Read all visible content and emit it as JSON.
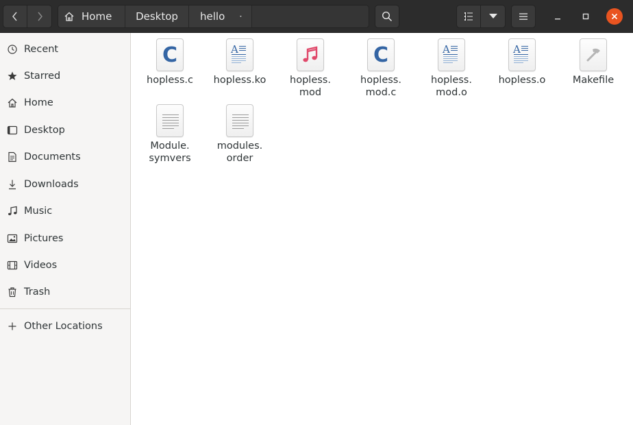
{
  "window": {
    "nav_back_icon": "chevron-left-icon",
    "nav_forward_icon": "chevron-right-icon"
  },
  "breadcrumb": {
    "items": [
      "Home",
      "Desktop",
      "hello"
    ]
  },
  "sidebar": {
    "items": [
      {
        "label": "Recent",
        "icon": "recent-icon"
      },
      {
        "label": "Starred",
        "icon": "star-icon"
      },
      {
        "label": "Home",
        "icon": "home-icon"
      },
      {
        "label": "Desktop",
        "icon": "desktop-icon"
      },
      {
        "label": "Documents",
        "icon": "documents-icon"
      },
      {
        "label": "Downloads",
        "icon": "downloads-icon"
      },
      {
        "label": "Music",
        "icon": "music-icon"
      },
      {
        "label": "Pictures",
        "icon": "pictures-icon"
      },
      {
        "label": "Videos",
        "icon": "videos-icon"
      },
      {
        "label": "Trash",
        "icon": "trash-icon"
      }
    ],
    "other_locations": "Other Locations"
  },
  "files": [
    {
      "line1": "hopless.c",
      "line2": "",
      "type": "c-source"
    },
    {
      "line1": "hopless.ko",
      "line2": "",
      "type": "text-doc"
    },
    {
      "line1": "hopless.",
      "line2": "mod",
      "type": "audio"
    },
    {
      "line1": "hopless.",
      "line2": "mod.c",
      "type": "c-source"
    },
    {
      "line1": "hopless.",
      "line2": "mod.o",
      "type": "text-doc"
    },
    {
      "line1": "hopless.o",
      "line2": "",
      "type": "text-doc"
    },
    {
      "line1": "Makefile",
      "line2": "",
      "type": "makefile"
    },
    {
      "line1": "Module.",
      "line2": "symvers",
      "type": "plain"
    },
    {
      "line1": "modules.",
      "line2": "order",
      "type": "plain"
    }
  ],
  "colors": {
    "accent_close": "#e95420",
    "c_glyph": "#3465a4",
    "music_glyph": "#e0486a"
  }
}
